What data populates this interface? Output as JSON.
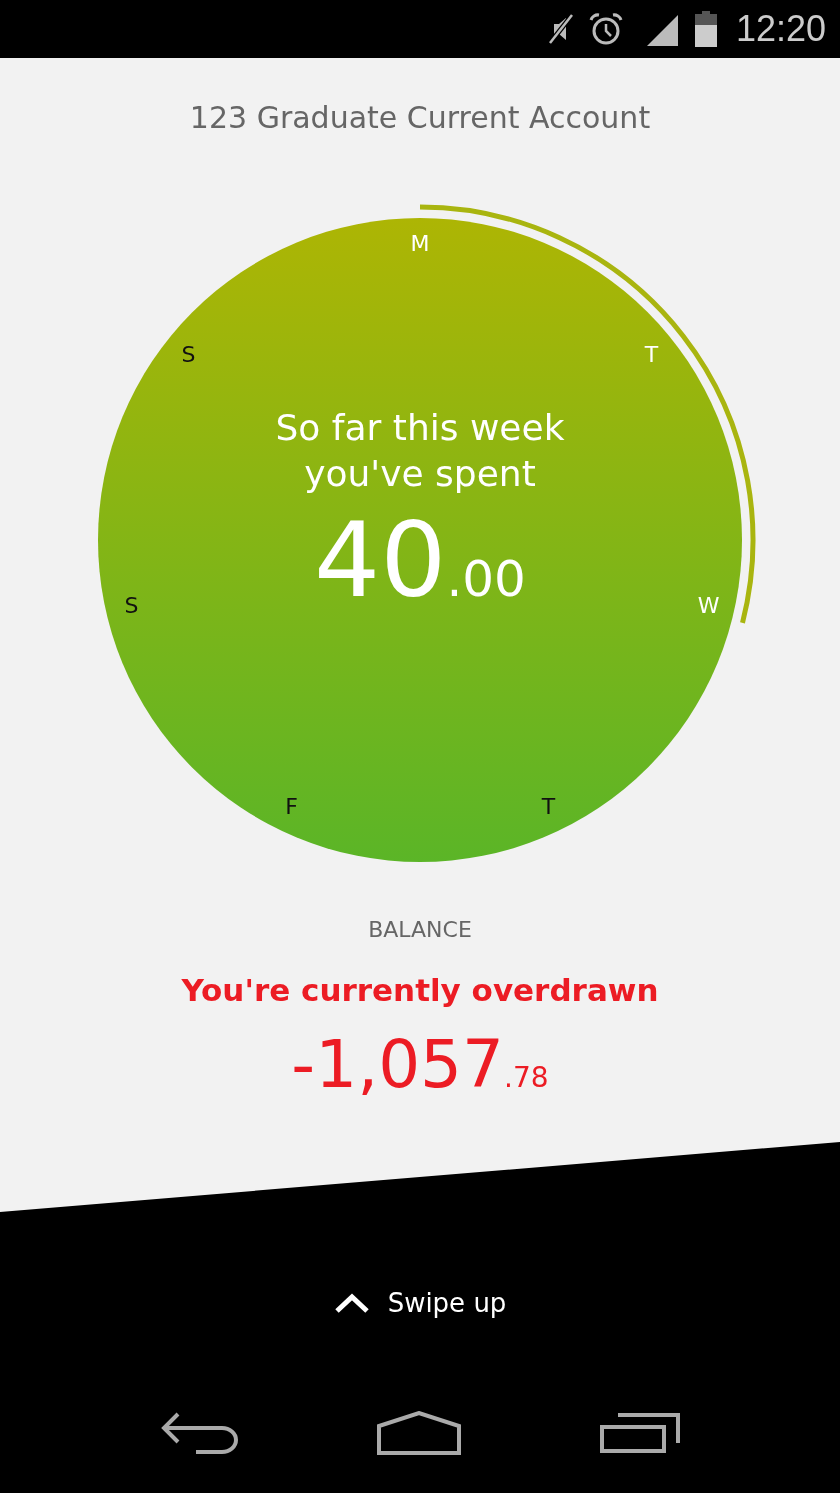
{
  "status_bar": {
    "time": "12:20"
  },
  "account": {
    "title": "123 Graduate Current Account"
  },
  "spending": {
    "caption": "So far this week you've spent",
    "amount_whole": "40",
    "amount_decimals": ".00",
    "days": [
      {
        "label": "M",
        "past": true
      },
      {
        "label": "T",
        "past": true
      },
      {
        "label": "W",
        "past": true
      },
      {
        "label": "T",
        "past": false
      },
      {
        "label": "F",
        "past": false
      },
      {
        "label": "S",
        "past": false
      },
      {
        "label": "S",
        "past": false
      }
    ]
  },
  "balance": {
    "label": "BALANCE",
    "status": "You're currently overdrawn",
    "amount_whole": "-1,057",
    "amount_decimals": ".78"
  },
  "swipe_hint": {
    "label": "Swipe up"
  }
}
